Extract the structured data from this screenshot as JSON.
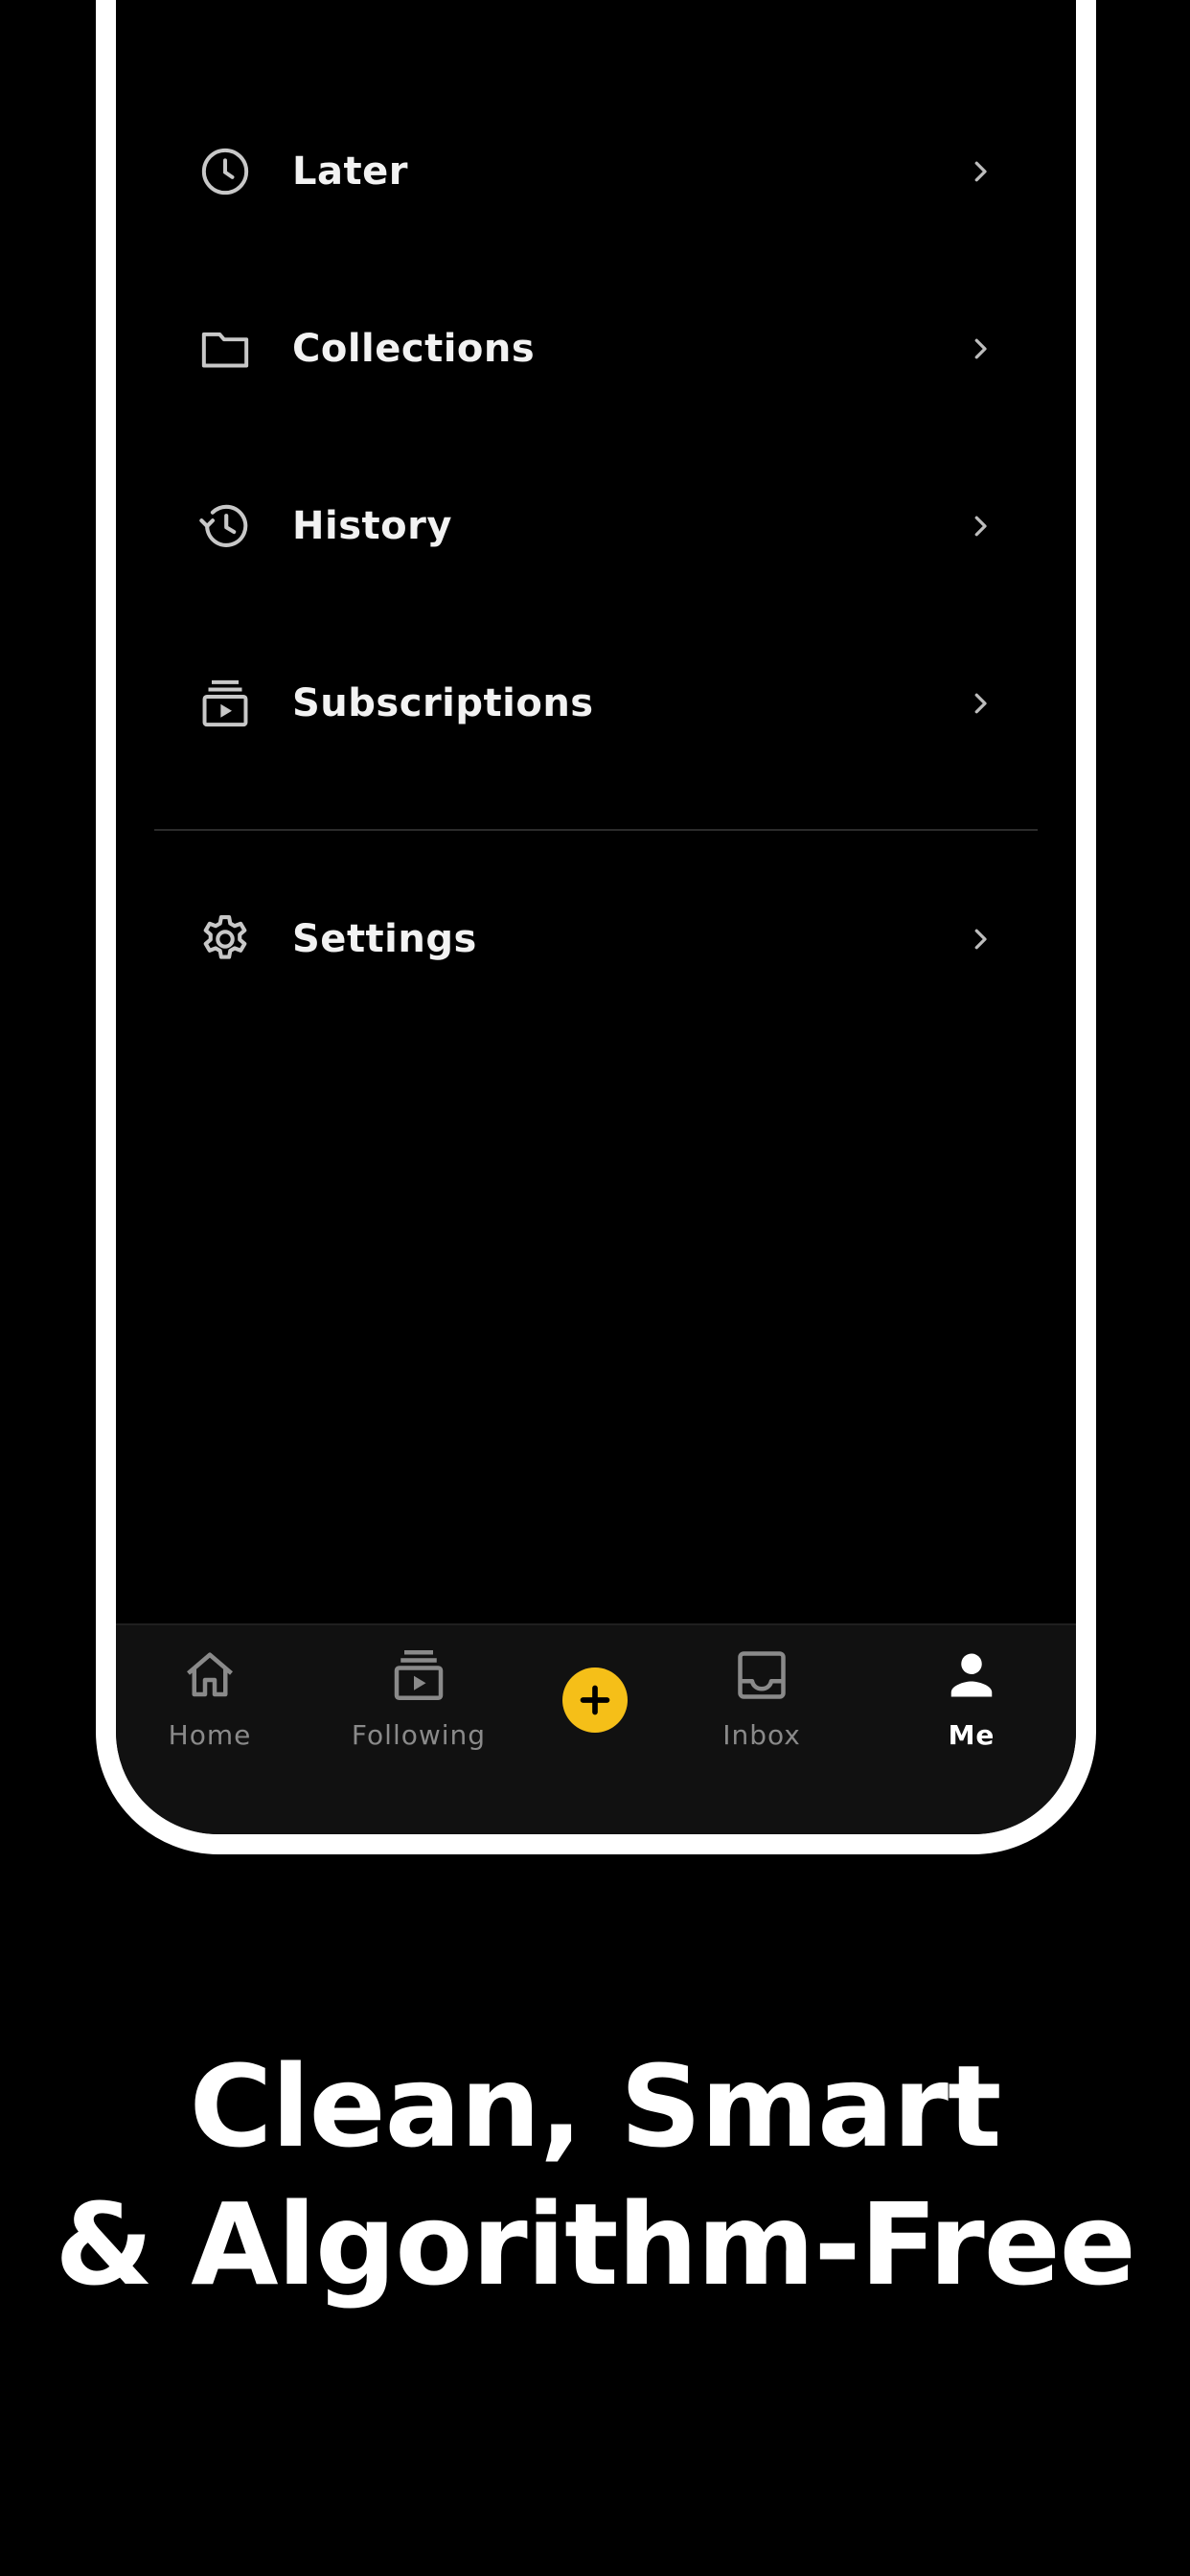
{
  "menu": {
    "items": [
      {
        "label": "Later",
        "icon": "clock-icon"
      },
      {
        "label": "Collections",
        "icon": "folder-icon"
      },
      {
        "label": "History",
        "icon": "history-icon"
      },
      {
        "label": "Subscriptions",
        "icon": "subscriptions-icon"
      }
    ],
    "settings": {
      "label": "Settings",
      "icon": "gear-icon"
    }
  },
  "tabbar": {
    "tabs": [
      {
        "label": "Home",
        "icon": "home-icon",
        "active": false
      },
      {
        "label": "Following",
        "icon": "following-icon",
        "active": false
      },
      {
        "label": "Inbox",
        "icon": "inbox-icon",
        "active": false
      },
      {
        "label": "Me",
        "icon": "person-icon",
        "active": true
      }
    ],
    "add_icon": "plus-icon"
  },
  "tagline": {
    "line1": "Clean, Smart",
    "line2": "& Algorithm-Free"
  },
  "colors": {
    "background": "#000000",
    "frame": "#ffffff",
    "accent": "#f5bf18",
    "tab_inactive": "#8a8a8a",
    "tab_active": "#ffffff"
  }
}
